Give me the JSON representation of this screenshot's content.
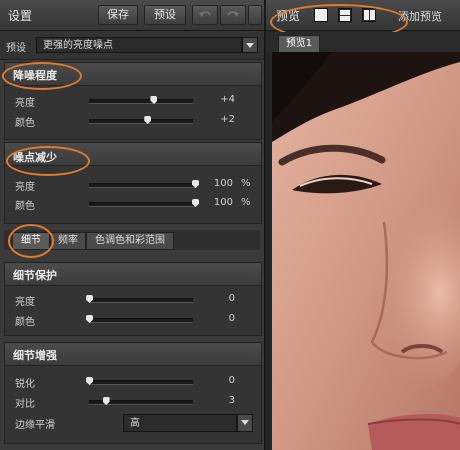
{
  "left_panel": {
    "title": "设置",
    "save_label": "保存",
    "preset_btn_label": "预设",
    "preset_label": "预设",
    "preset_value": "更强的亮度噪点"
  },
  "noise_reduction": {
    "title": "降噪程度",
    "brightness_label": "亮度",
    "brightness_value": "+4",
    "brightness_fraction": 0.62,
    "color_label": "颜色",
    "color_value": "+2",
    "color_fraction": 0.56
  },
  "noise_points": {
    "title": "噪点减少",
    "brightness_label": "亮度",
    "brightness_value": "100",
    "brightness_unit": "%",
    "brightness_fraction": 1.0,
    "color_label": "颜色",
    "color_value": "100",
    "color_unit": "%",
    "color_fraction": 1.0
  },
  "tabs": [
    "细节",
    "频率",
    "色调色和彩范围"
  ],
  "detail_protect": {
    "title": "细节保护",
    "brightness_label": "亮度",
    "brightness_value": "0",
    "brightness_fraction": 0.0,
    "color_label": "颜色",
    "color_value": "0",
    "color_fraction": 0.0
  },
  "detail_enhance": {
    "title": "细节增强",
    "sharpen_label": "锐化",
    "sharpen_value": "0",
    "sharpen_fraction": 0.0,
    "contrast_label": "对比",
    "contrast_value": "3",
    "contrast_fraction": 0.16,
    "edge_label": "边缘平滑",
    "edge_value": "高"
  },
  "right_panel": {
    "preview_label": "预览",
    "add_preview_label": "添加预览",
    "tab_label": "预览1"
  },
  "colors": {
    "highlight": "#e07a2e",
    "panel": "#3a3a3a"
  },
  "icons": [
    "undo-icon",
    "redo-icon",
    "chevron-down-icon",
    "single-view-icon",
    "split-horizontal-icon",
    "split-vertical-icon"
  ]
}
